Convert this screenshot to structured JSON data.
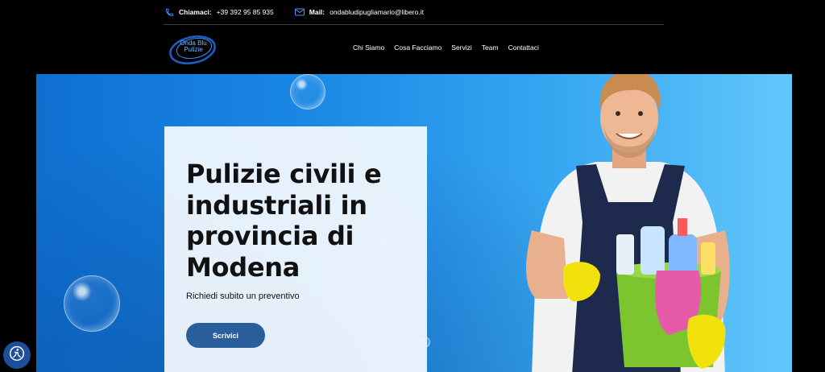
{
  "topbar": {
    "phone_label": "Chiamaci:",
    "phone_value": "+39 392 95 85 935",
    "mail_label": "Mail:",
    "mail_value": "ondabludipugliamario@libero.it"
  },
  "logo": {
    "line1": "Onda Blu",
    "line2": "Pulizie"
  },
  "nav": {
    "items": [
      "Chi Siamo",
      "Cosa Facciamo",
      "Servizi",
      "Team",
      "Contattaci"
    ]
  },
  "hero": {
    "headline": "Pulizie civili e industriali in provincia di Modena",
    "subline": "Richiedi subito un preventivo",
    "cta_label": "Scrivici"
  },
  "colors": {
    "hero_blue": "#1a87e4",
    "button": "#2a5f9e",
    "background": "#000000"
  },
  "icons": [
    "phone-icon",
    "mail-icon",
    "accessibility-icon"
  ]
}
